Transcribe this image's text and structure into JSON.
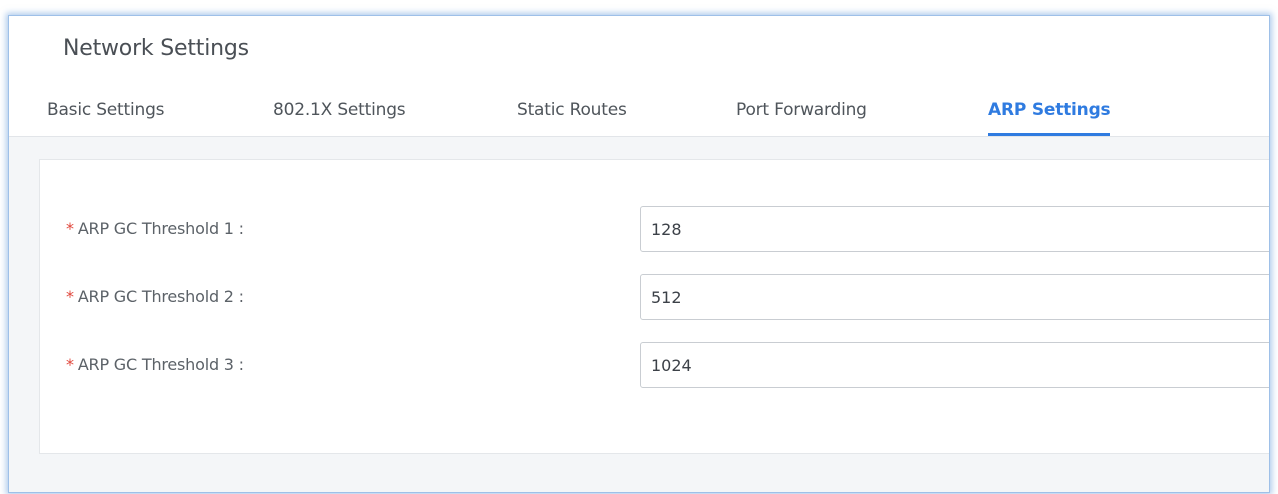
{
  "header": {
    "title": "Network Settings"
  },
  "tabs": [
    {
      "label": "Basic Settings",
      "active": false
    },
    {
      "label": "802.1X Settings",
      "active": false
    },
    {
      "label": "Static Routes",
      "active": false
    },
    {
      "label": "Port Forwarding",
      "active": false
    },
    {
      "label": "ARP Settings",
      "active": true
    }
  ],
  "form": {
    "fields": [
      {
        "required_mark": "*",
        "label": "ARP GC Threshold 1 :",
        "value": "128"
      },
      {
        "required_mark": "*",
        "label": "ARP GC Threshold 2 :",
        "value": "512"
      },
      {
        "required_mark": "*",
        "label": "ARP GC Threshold 3 :",
        "value": "1024"
      }
    ]
  },
  "colors": {
    "accent": "#2f7be0",
    "required": "#e0453a"
  }
}
